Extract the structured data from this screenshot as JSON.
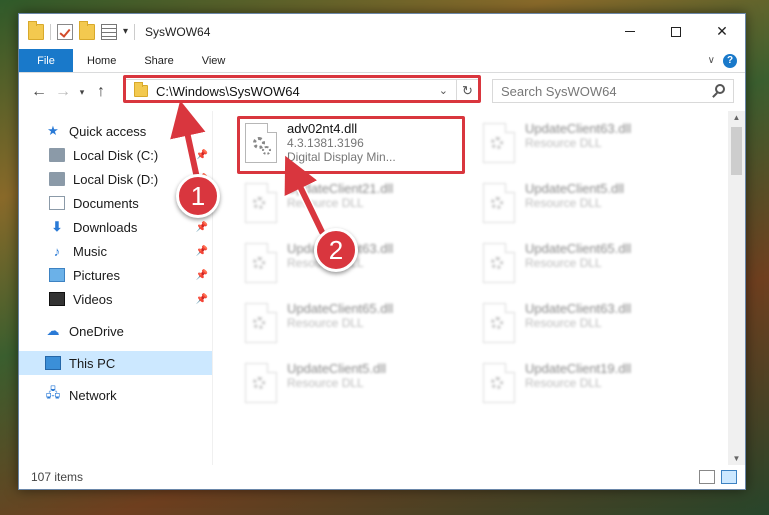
{
  "window": {
    "title": "SysWOW64",
    "controls": {
      "minimize_icon": "minimize-icon",
      "maximize_icon": "maximize-icon",
      "close_glyph": "✕"
    }
  },
  "ribbon": {
    "tabs": [
      {
        "label": "File"
      },
      {
        "label": "Home"
      },
      {
        "label": "Share"
      },
      {
        "label": "View"
      }
    ]
  },
  "address": {
    "path": "C:\\Windows\\SysWOW64",
    "search_placeholder": "Search SysWOW64"
  },
  "nav": {
    "quick_access": "Quick access",
    "items": [
      {
        "label": "Local Disk (C:)",
        "icon": "disk-icon",
        "pinned": true
      },
      {
        "label": "Local Disk (D:)",
        "icon": "disk-icon",
        "pinned": true
      },
      {
        "label": "Documents",
        "icon": "documents-icon",
        "pinned": true
      },
      {
        "label": "Downloads",
        "icon": "downloads-icon",
        "pinned": true
      },
      {
        "label": "Music",
        "icon": "music-icon",
        "pinned": true
      },
      {
        "label": "Pictures",
        "icon": "pictures-icon",
        "pinned": true
      },
      {
        "label": "Videos",
        "icon": "videos-icon",
        "pinned": true
      }
    ],
    "onedrive": "OneDrive",
    "this_pc": "This PC",
    "network": "Network"
  },
  "files": {
    "highlighted": {
      "name": "adv02nt4.dll",
      "version": "4.3.1381.3196",
      "description": "Digital Display Min..."
    },
    "others": [
      {
        "name": "UpdateClient63.dll",
        "type": "Resource DLL"
      },
      {
        "name": "UpdateClient21.dll",
        "type": "Resource DLL"
      },
      {
        "name": "UpdateClient5.dll",
        "type": "Resource DLL"
      },
      {
        "name": "UpdateClient63.dll",
        "type": "Resource DLL"
      },
      {
        "name": "UpdateClient65.dll",
        "type": "Resource DLL"
      },
      {
        "name": "UpdateClient65.dll",
        "type": "Resource DLL"
      },
      {
        "name": "UpdateClient63.dll",
        "type": "Resource DLL"
      },
      {
        "name": "UpdateClient5.dll",
        "type": "Resource DLL"
      },
      {
        "name": "UpdateClient19.dll",
        "type": "Resource DLL"
      }
    ]
  },
  "status": {
    "item_count": "107 items"
  },
  "callouts": {
    "one": "1",
    "two": "2",
    "color": "#d9363e"
  }
}
